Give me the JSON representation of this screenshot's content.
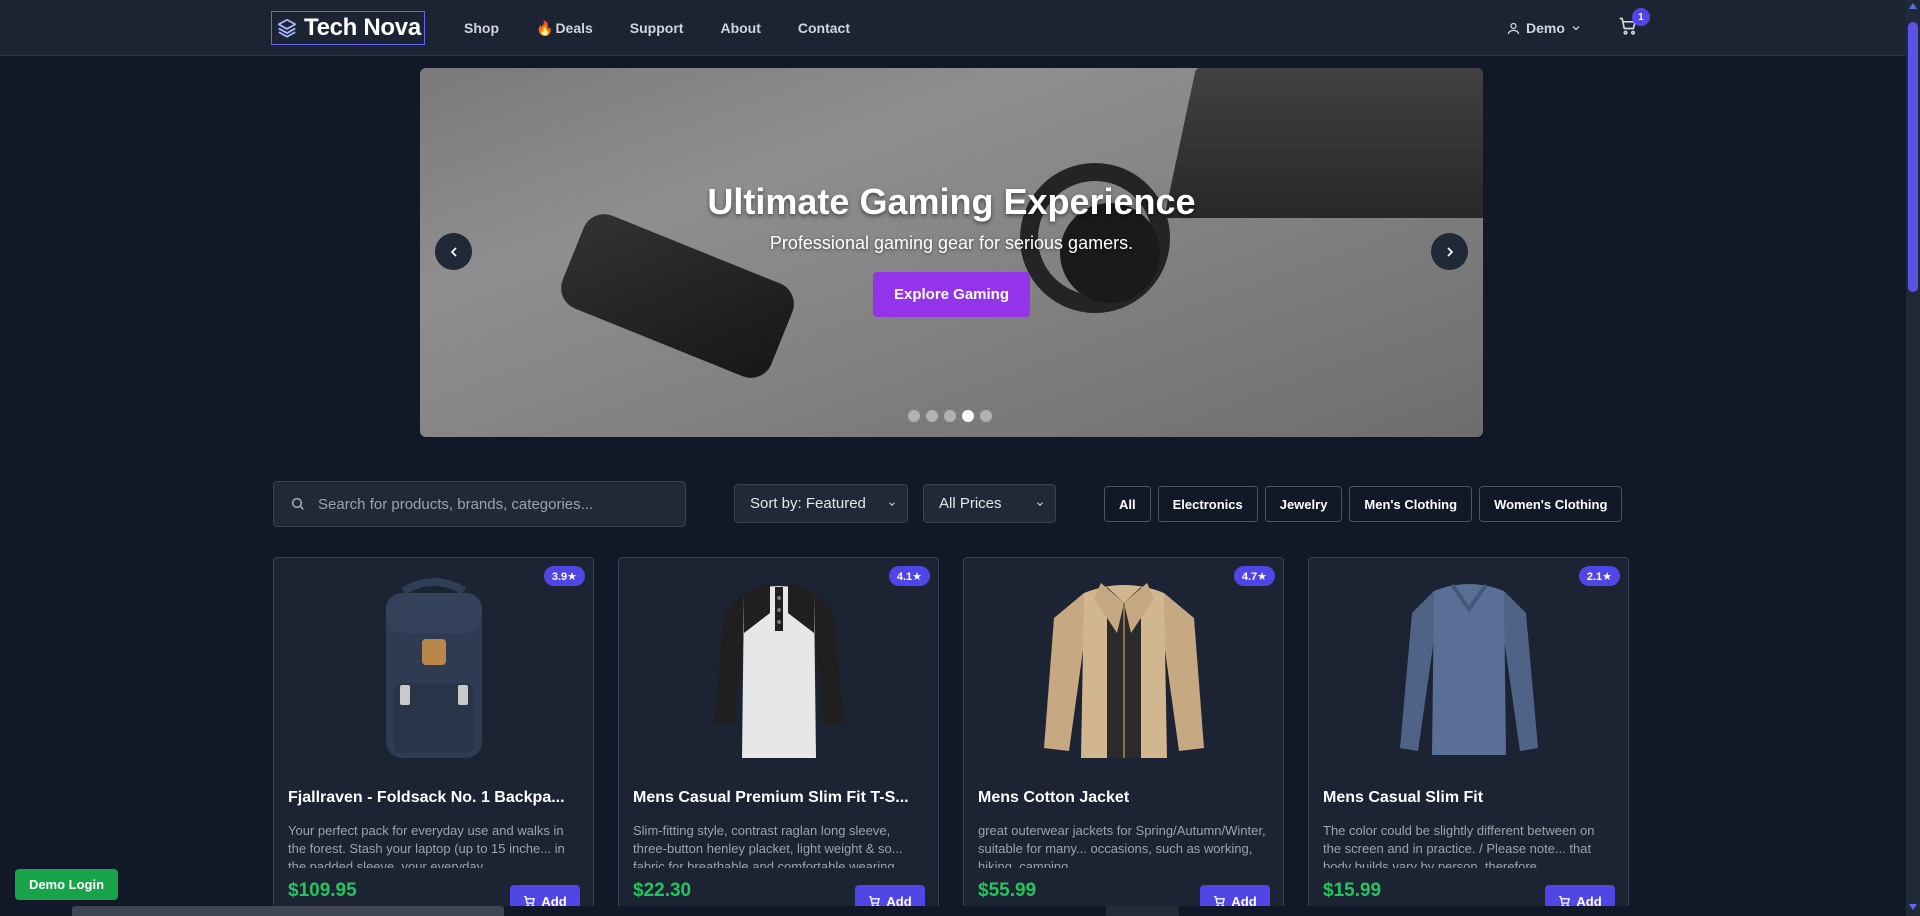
{
  "brand": {
    "name": "Tech Nova",
    "logo_icon": "layers-icon",
    "accent": "#6366f1"
  },
  "nav": {
    "links": [
      {
        "label": "Shop"
      },
      {
        "label": "Deals",
        "icon": "fire-emoji"
      },
      {
        "label": "Support"
      },
      {
        "label": "About"
      },
      {
        "label": "Contact"
      }
    ],
    "user_label": "Demo",
    "cart_count": "1"
  },
  "hero": {
    "title": "Ultimate Gaming Experience",
    "subtitle": "Professional gaming gear for serious gamers.",
    "cta": "Explore Gaming",
    "cta_color": "#9333ea",
    "slides_total": 5,
    "active_slide": 4
  },
  "filters": {
    "search_placeholder": "Search for products, brands, categories...",
    "sort_label": "Sort by: Featured",
    "price_label": "All Prices",
    "categories": [
      "All",
      "Electronics",
      "Jewelry",
      "Men's Clothing",
      "Women's Clothing"
    ]
  },
  "products": [
    {
      "title": "Fjallraven - Foldsack No. 1 Backpa...",
      "description": "Your perfect pack for everyday use and walks in the forest. Stash your laptop (up to 15 inche... in the padded sleeve, your everyday",
      "price": "$109.95",
      "rating": "3.9★",
      "add_label": "Add"
    },
    {
      "title": "Mens Casual Premium Slim Fit T-S...",
      "description": "Slim-fitting style, contrast raglan long sleeve, three-button henley placket, light weight & so... fabric for breathable and comfortable wearing",
      "price": "$22.30",
      "rating": "4.1★",
      "add_label": "Add"
    },
    {
      "title": "Mens Cotton Jacket",
      "description": "great outerwear jackets for Spring/Autumn/Winter, suitable for many... occasions, such as working, hiking, camping",
      "price": "$55.99",
      "rating": "4.7★",
      "add_label": "Add"
    },
    {
      "title": "Mens Casual Slim Fit",
      "description": "The color could be slightly different between on the screen and in practice. / Please note... that body builds vary by person, therefore",
      "price": "$15.99",
      "rating": "2.1★",
      "add_label": "Add"
    }
  ],
  "demo_login": "Demo Login",
  "colors": {
    "background": "#111827",
    "card": "#1c2433",
    "price": "#22c55e",
    "badge": "#4f46e5",
    "login": "#16a34a"
  }
}
